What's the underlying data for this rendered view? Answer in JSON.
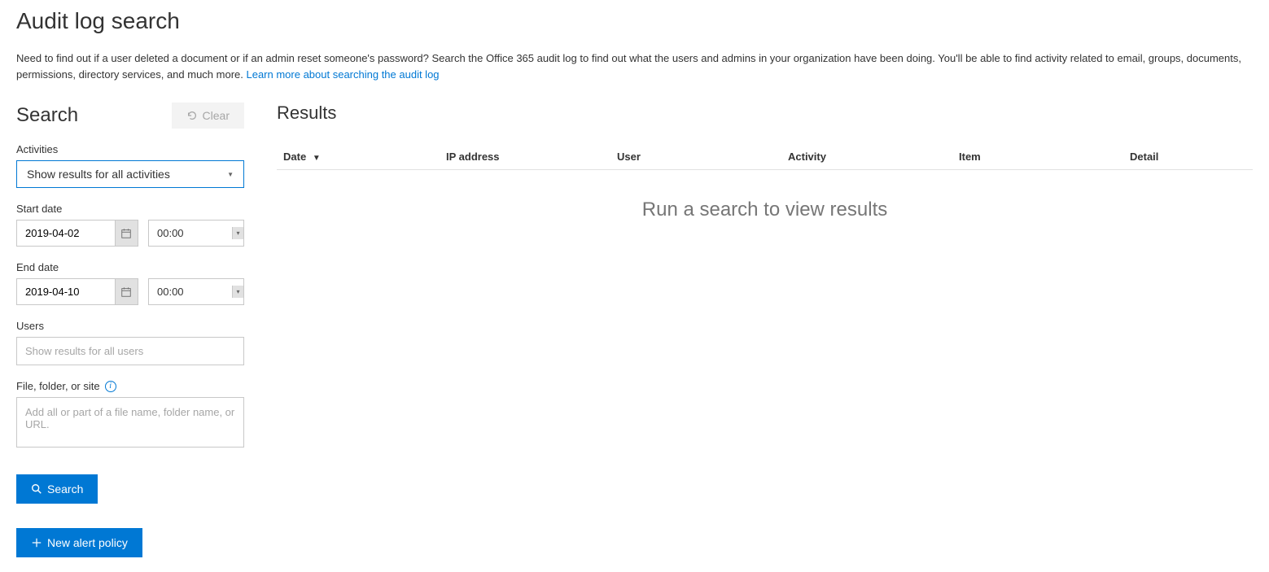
{
  "page": {
    "title": "Audit log search",
    "description_prefix": "Need to find out if a user deleted a document or if an admin reset someone's password? Search the Office 365 audit log to find out what the users and admins in your organization have been doing. You'll be able to find activity related to email, groups, documents, permissions, directory services, and much more. ",
    "description_link": "Learn more about searching the audit log"
  },
  "search": {
    "title": "Search",
    "clear_label": "Clear",
    "activities": {
      "label": "Activities",
      "selected": "Show results for all activities"
    },
    "start_date": {
      "label": "Start date",
      "value": "2019-04-02",
      "time": "00:00"
    },
    "end_date": {
      "label": "End date",
      "value": "2019-04-10",
      "time": "00:00"
    },
    "users": {
      "label": "Users",
      "placeholder": "Show results for all users"
    },
    "file": {
      "label": "File, folder, or site",
      "placeholder": "Add all or part of a file name, folder name, or URL."
    },
    "search_button": "Search",
    "new_alert_button": "New alert policy"
  },
  "results": {
    "title": "Results",
    "columns": {
      "date": "Date",
      "ip": "IP address",
      "user": "User",
      "activity": "Activity",
      "item": "Item",
      "detail": "Detail"
    },
    "empty_message": "Run a search to view results"
  }
}
